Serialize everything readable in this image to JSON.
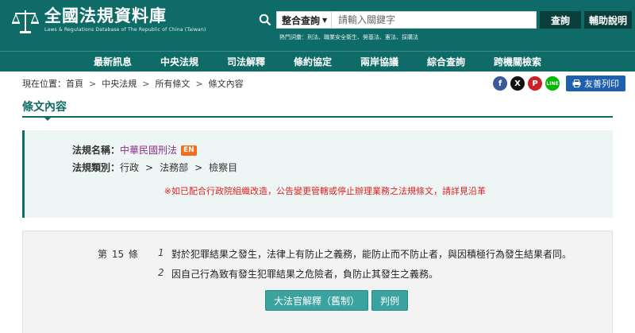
{
  "header": {
    "site_title": "全國法規資料庫",
    "site_subtitle": "Laws & Regulations Database of The Republic of China (Taiwan)",
    "search": {
      "select_value": "整合查詢",
      "placeholder": "請輸入關鍵字",
      "query_label": "查詢",
      "help_label": "輔助說明"
    },
    "hot_label": "熱門詞彙：",
    "hot_terms": [
      "刑法",
      "職業安全衛生",
      "勞基法",
      "憲法",
      "採購法"
    ]
  },
  "nav": {
    "items": [
      "最新訊息",
      "中央法規",
      "司法解釋",
      "條約協定",
      "兩岸協議",
      "綜合查詢",
      "跨機關檢索"
    ]
  },
  "breadcrumb": {
    "prefix": "現在位置：",
    "items": [
      "首頁",
      "中央法規",
      "所有條文",
      "條文內容"
    ]
  },
  "share": {
    "facebook": "f",
    "x": "X",
    "pinterest": "P",
    "line": "LINE",
    "print_label": "友善列印"
  },
  "section_title": "條文內容",
  "law_info": {
    "name_label": "法規名稱：",
    "name": "中華民國刑法",
    "en_badge": "EN",
    "category_label": "法規類別：",
    "categories": [
      "行政",
      "法務部",
      "檢察目"
    ],
    "category_sep": ">",
    "notice": "※如已配合行政院組織改造，公告變更管轄或停止辦理業務之法規條文，請詳見沿革"
  },
  "article": {
    "number": "第 15 條",
    "paragraphs": [
      {
        "num": "1",
        "text": "對於犯罪結果之發生，法律上有防止之義務，能防止而不防止者，與因積極行為發生結果者同。"
      },
      {
        "num": "2",
        "text": "因自己行為致有發生犯罪結果之危險者，負防止其發生之義務。"
      }
    ],
    "buttons": [
      "大法官解釋（舊制）",
      "判例"
    ]
  },
  "colors": {
    "brand": "#0f6b67",
    "notice": "#dd2222",
    "law_name": "#8a2f8a",
    "en_badge": "#f07020",
    "print_button": "#1f5fb0"
  }
}
